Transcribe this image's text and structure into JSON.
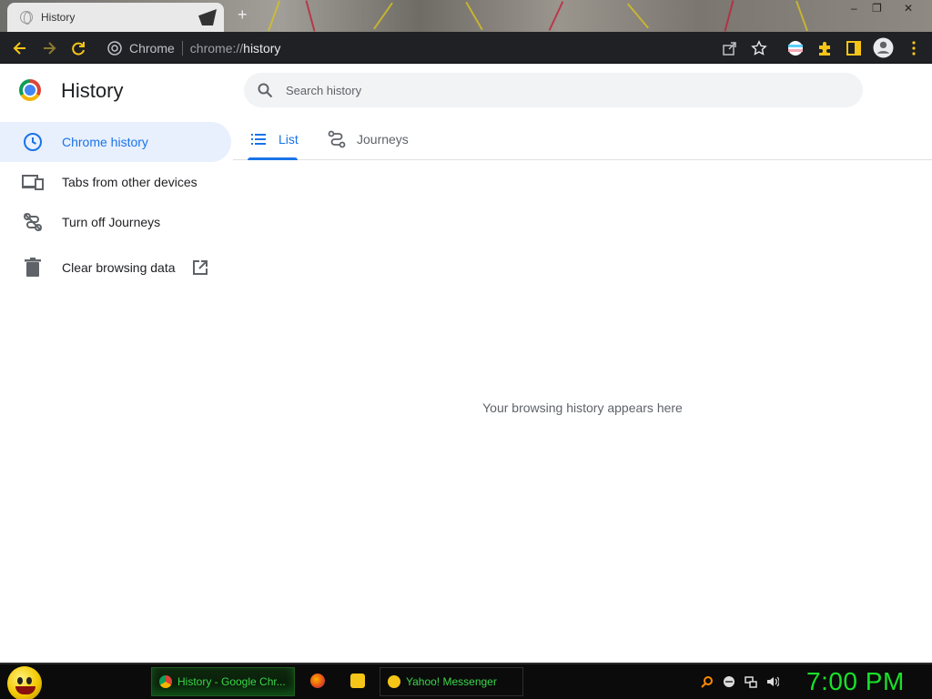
{
  "browser": {
    "tab_title": "History",
    "new_tab_symbol": "+",
    "window_controls": [
      "–",
      "❐",
      "✕"
    ],
    "omnibox_site": "Chrome",
    "url_prefix": "chrome://",
    "url_path": "history",
    "toolbar_icons": [
      "back-icon",
      "forward-icon",
      "reload-icon",
      "share-icon",
      "star-icon",
      "profile-flag-icon",
      "extensions-icon",
      "side-panel-icon",
      "account-icon",
      "menu-icon"
    ]
  },
  "page": {
    "title": "History",
    "search_placeholder": "Search history",
    "sidebar": [
      {
        "label": "Chrome history",
        "icon": "clock-icon",
        "active": true
      },
      {
        "label": "Tabs from other devices",
        "icon": "devices-icon",
        "active": false
      },
      {
        "label": "Turn off Journeys",
        "icon": "journeys-off-icon",
        "active": false
      },
      {
        "label": "Clear browsing data",
        "icon": "trash-icon",
        "active": false,
        "external": true
      }
    ],
    "tabs": [
      {
        "label": "List",
        "icon": "list-icon",
        "active": true
      },
      {
        "label": "Journeys",
        "icon": "journeys-icon",
        "active": false
      }
    ],
    "empty_message": "Your browsing history appears here"
  },
  "taskbar": {
    "tasks": [
      {
        "label": "History - Google Chr...",
        "active": true
      },
      {
        "label": "Yahoo! Messenger",
        "active": false
      }
    ],
    "clock": "7:00 PM"
  },
  "colors": {
    "accent": "#1a73e8",
    "active_bg": "#e8f0fe",
    "toolbar_bg": "#202124",
    "taskbar_text": "#19e02a"
  }
}
